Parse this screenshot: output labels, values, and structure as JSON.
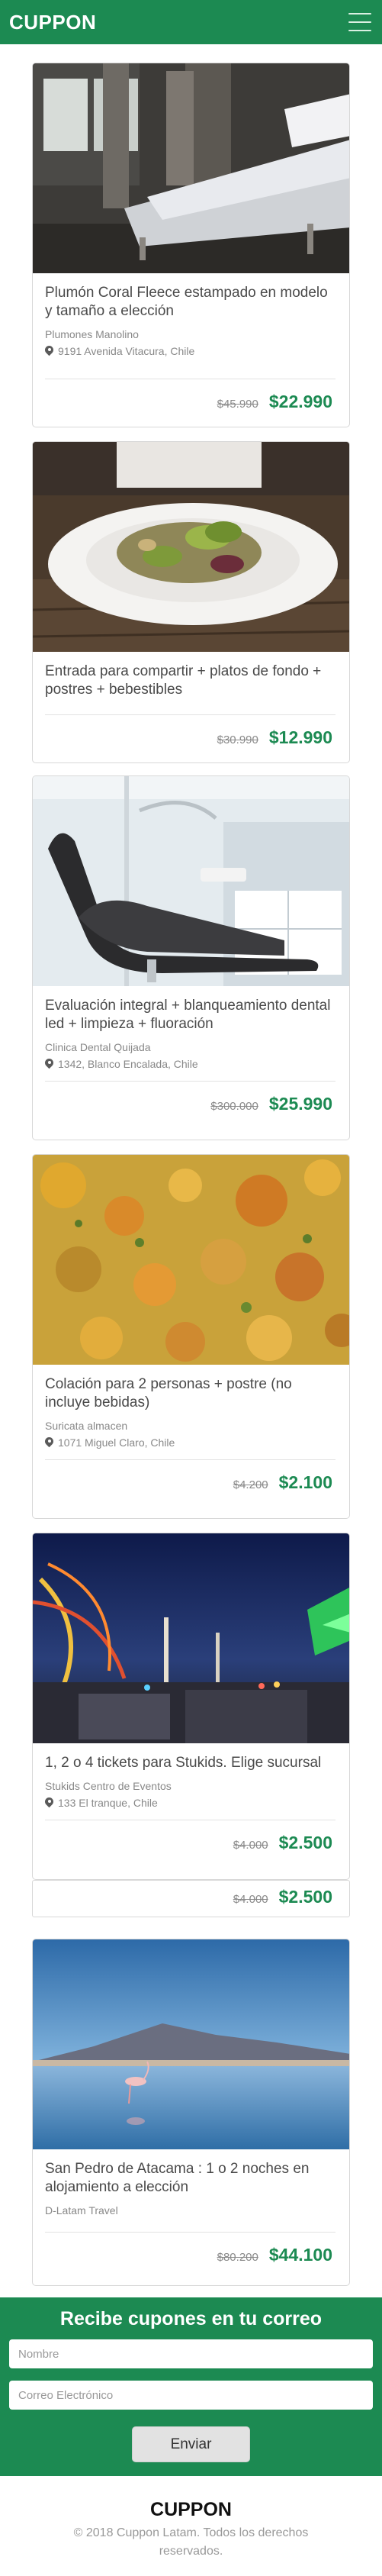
{
  "header": {
    "logo": "CUPPON",
    "menu_icon": "hamburger-menu-icon"
  },
  "deals": [
    {
      "title": "Plumón Coral Fleece estampado en modelo y tamaño a elección",
      "merchant": "Plumones Manolino",
      "address": "9191 Avenida Vitacura, Chile",
      "old_price": "$45.990",
      "new_price": "$22.990",
      "image": "bedroom-bed-photo"
    },
    {
      "title": "Entrada para compartir + platos de fondo + postres + bebestibles",
      "merchant": "",
      "address": "",
      "old_price": "$30.990",
      "new_price": "$12.990",
      "image": "salad-plate-photo"
    },
    {
      "title": "Evaluación integral + blanqueamiento dental led + limpieza + fluoración",
      "merchant": "Clinica Dental Quijada",
      "address": "1342, Blanco Encalada, Chile",
      "old_price": "$300.000",
      "new_price": "$25.990",
      "image": "dental-chair-photo"
    },
    {
      "title": "Colación para 2 personas + postre (no incluye bebidas)",
      "merchant": "Suricata almacen",
      "address": "1071 Miguel Claro, Chile",
      "old_price": "$4.200",
      "new_price": "$2.100",
      "image": "vegetable-stew-photo"
    },
    {
      "title": "1, 2 o 4 tickets para Stukids. Elige sucursal",
      "merchant": "Stukids Centro de Eventos",
      "address": "133 El tranque, Chile",
      "old_price": "$4.000",
      "new_price": "$2.500",
      "image": "amusement-park-photo"
    },
    {
      "title": "San Pedro de Atacama : 1 o 2 noches en alojamiento a elección",
      "merchant": "D-Latam Travel",
      "address": "",
      "old_price": "$80.200",
      "new_price": "$44.100",
      "image": "flamingo-lake-photo"
    }
  ],
  "extra_price": {
    "old_price": "$4.000",
    "new_price": "$2.500"
  },
  "newsletter": {
    "title": "Recibe cupones en tu correo",
    "name_placeholder": "Nombre",
    "email_placeholder": "Correo Electrónico",
    "submit_label": "Enviar"
  },
  "footer": {
    "logo": "CUPPON",
    "copyright": "© 2018 Cuppon Latam. Todos los derechos reservados."
  },
  "colors": {
    "brand": "#1c8a52",
    "price": "#1c8a52"
  }
}
